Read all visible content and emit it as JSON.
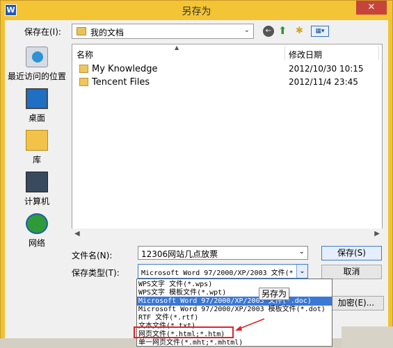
{
  "window": {
    "title": "另存为",
    "app_icon": "W",
    "close_glyph": "✕"
  },
  "toolbar": {
    "save_in_label": "保存在(I):",
    "save_in_value": "我的文档",
    "icons": [
      "back-icon",
      "up-folder-icon",
      "new-folder-icon",
      "view-menu-icon"
    ]
  },
  "places": [
    {
      "label": "最近访问的位置",
      "icon": "recent-places-icon"
    },
    {
      "label": "桌面",
      "icon": "desktop-icon"
    },
    {
      "label": "库",
      "icon": "library-icon"
    },
    {
      "label": "计算机",
      "icon": "computer-icon"
    },
    {
      "label": "网络",
      "icon": "network-icon"
    }
  ],
  "filelist": {
    "columns": {
      "name": "名称",
      "date": "修改日期"
    },
    "rows": [
      {
        "name": "My Knowledge",
        "date": "2012/10/30 10:15"
      },
      {
        "name": "Tencent Files",
        "date": "2012/11/4 23:45"
      }
    ]
  },
  "form": {
    "filename_label": "文件名(N):",
    "filename_value": "12306网站几点放票",
    "filetype_label": "保存类型(T):",
    "filetype_value": "Microsoft Word 97/2000/XP/2003 文件(*",
    "save_button": "保存(S)",
    "cancel_button": "取消",
    "encrypt_button": "加密(E)..."
  },
  "dropdown": {
    "items": [
      "WPS文字 文件(*.wps)",
      "WPS文字 模板文件(*.wpt)",
      "Microsoft Word 97/2000/XP/2003 文件(*.doc)",
      "Microsoft Word 97/2000/XP/2003 模板文件(*.dot)",
      "RTF 文件(*.rtf)",
      "文本文件(*.txt)",
      "网页文件(*.html;*.htm)",
      "单一网页文件(*.mht;*.mhtml)"
    ],
    "selected_index": 2,
    "highlighted_annotation_index": 6
  },
  "tooltip": "另存为",
  "colors": {
    "selection": "#3a78d6",
    "annotation": "#e3202a",
    "title_bar": "#f3c434"
  }
}
